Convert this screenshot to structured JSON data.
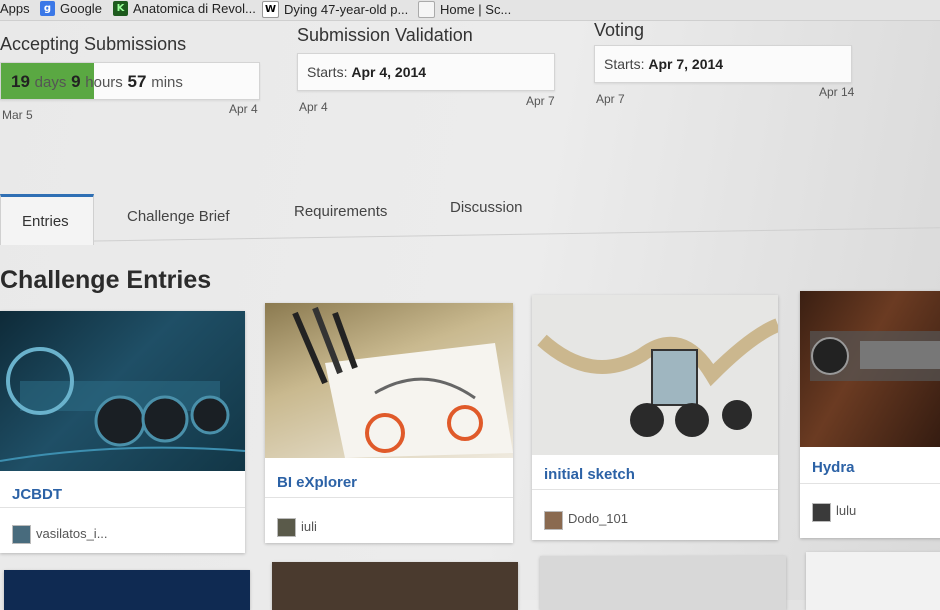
{
  "bookmarks": [
    {
      "label": "Apps",
      "icon": "apps-icon"
    },
    {
      "label": "Google",
      "icon": "google-icon"
    },
    {
      "label": "Anatomica di Revol...",
      "icon": "k-site-icon"
    },
    {
      "label": "Dying 47-year-old p...",
      "icon": "w-site-icon"
    },
    {
      "label": "Home | Sc...",
      "icon": "doc-icon"
    }
  ],
  "timeline": {
    "accepting": {
      "title": "Accepting Submissions",
      "days": "19",
      "days_unit": "days",
      "hours": "9",
      "hours_unit": "hours",
      "mins": "57",
      "mins_unit": "mins",
      "start": "Mar 5",
      "end": "Apr 4",
      "progress": 0.36
    },
    "validation": {
      "title": "Submission Validation",
      "starts_label": "Starts:",
      "starts_date": "Apr 4, 2014",
      "start": "Apr 4",
      "end": "Apr 7"
    },
    "voting": {
      "title": "Voting",
      "starts_label": "Starts:",
      "starts_date": "Apr 7, 2014",
      "start": "Apr 7",
      "end": "Apr 14"
    }
  },
  "tabs": [
    "Entries",
    "Challenge Brief",
    "Requirements",
    "Discussion"
  ],
  "entries_title": "Challenge Entries",
  "entries": [
    {
      "name": "JCBDT",
      "user": "vasilatos_i...",
      "thumb_color": "#1f4f66"
    },
    {
      "name": "BI eXplorer",
      "user": "iuli",
      "thumb_color": "#c9b98f"
    },
    {
      "name": "initial sketch",
      "user": "Dodo_101",
      "thumb_color": "#e6e6e4"
    },
    {
      "name": "Hydra",
      "user": "lulu",
      "thumb_color": "#5a3220"
    }
  ],
  "accent": {
    "tab_active": "#2f6fb4",
    "progress": "#5aa842",
    "link": "#2c62a6"
  }
}
